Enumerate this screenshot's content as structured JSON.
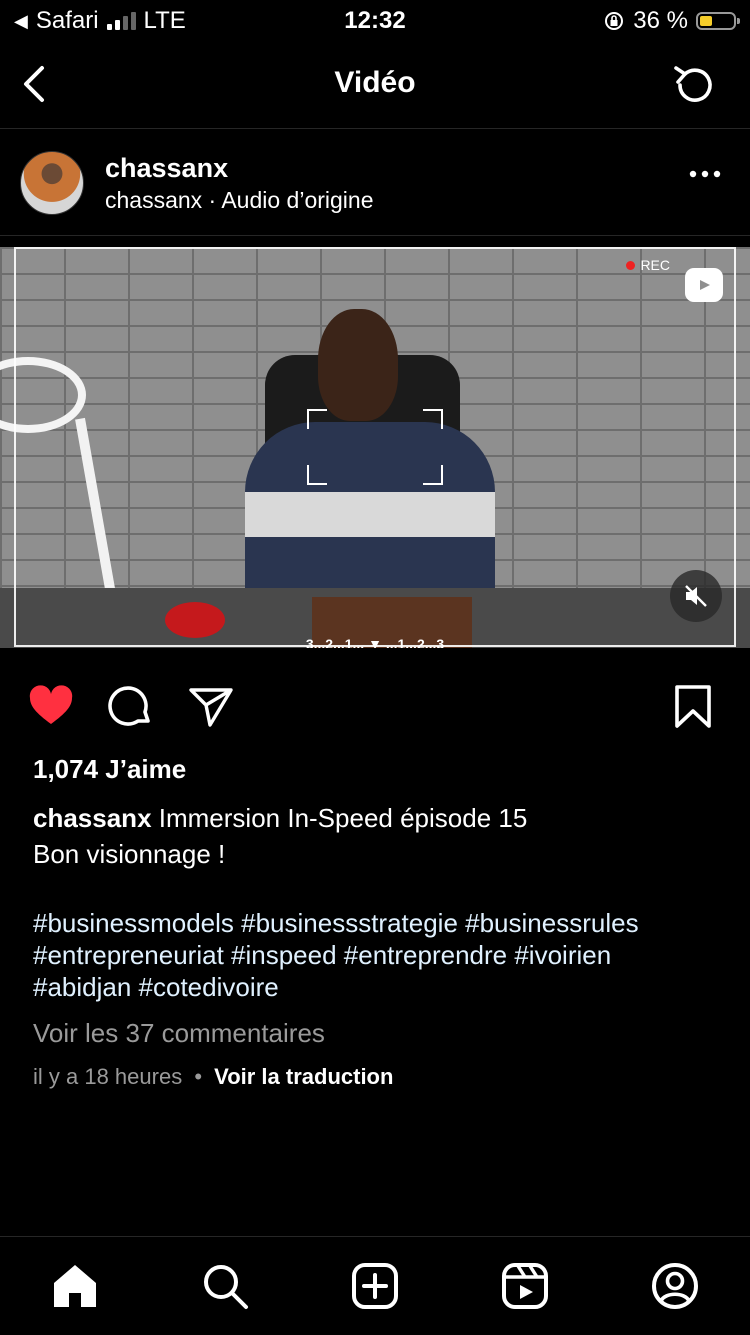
{
  "status_bar": {
    "back_app": "Safari",
    "network": "LTE",
    "time": "12:32",
    "battery_percent": "36 %",
    "battery_level": 0.36,
    "battery_color": "#f5cd2a"
  },
  "nav": {
    "title": "Vidéo",
    "back_icon": "chevron-left-icon",
    "refresh_icon": "refresh-icon"
  },
  "post": {
    "username": "chassanx",
    "audio_line": "chassanx · Audio d’origine",
    "more_icon": "ellipsis-icon"
  },
  "video": {
    "rec_label": "REC",
    "countdown": "3...2...1... ▼ ...1...2...3",
    "muted_icon": "speaker-muted-icon",
    "reel_badge_icon": "reels-icon"
  },
  "actions": {
    "like_icon": "heart-filled-icon",
    "like_color": "#ff3040",
    "comment_icon": "comment-icon",
    "share_icon": "send-icon",
    "save_icon": "bookmark-icon"
  },
  "likes_text": "1,074 J’aime",
  "caption": {
    "username": "chassanx",
    "text_line1": "Immersion In-Speed  épisode 15",
    "text_line2": "Bon visionnage !",
    "hashtags_line1": "#businessmodels #businessstrategie #businessrules",
    "hashtags_line2": "#entrepreneuriat #inspeed  #entreprendre #ivoirien",
    "hashtags_line3": "#abidjan #cotedivoire"
  },
  "comments_link": "Voir les 37 commentaires",
  "meta": {
    "time_ago": "il y a 18 heures",
    "separator": "•",
    "translate_link": "Voir la traduction"
  },
  "tabbar": {
    "items": [
      "home-icon",
      "search-icon",
      "create-icon",
      "reels-icon",
      "profile-icon"
    ]
  }
}
